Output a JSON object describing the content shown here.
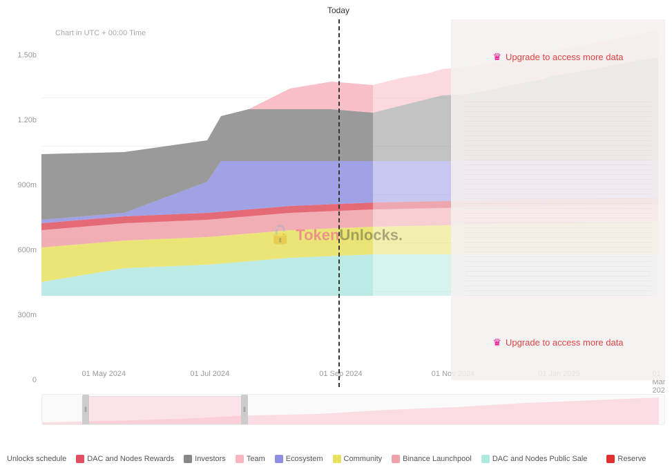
{
  "chart": {
    "title": "Unlocks schedule",
    "subtitle": "Chart in UTC + 00:00 Time",
    "today_label": "Today",
    "watermark": "TokenUnlocks.",
    "y_axis": {
      "labels": [
        "0",
        "300m",
        "600m",
        "900m",
        "1.20b",
        "1.50b"
      ]
    },
    "x_axis": {
      "labels": [
        "01 May 2024",
        "01 Jul 2024",
        "01 Sep 2024",
        "01 Nov 2024",
        "01 Jan 2025",
        "01 Mar 202"
      ]
    },
    "upgrade_messages": [
      "Upgrade to access more data",
      "Upgrade to access more data"
    ]
  },
  "legend": {
    "items": [
      {
        "label": "Unlocks schedule",
        "color": null
      },
      {
        "label": "DAC and Nodes Rewards",
        "color": "#e05060"
      },
      {
        "label": "Investors",
        "color": "#888888"
      },
      {
        "label": "Team",
        "color": "#f8b4c0"
      },
      {
        "label": "Ecosystem",
        "color": "#9090e0"
      },
      {
        "label": "Community",
        "color": "#e8e060"
      },
      {
        "label": "Binance Launchpool",
        "color": "#f0a0a8"
      },
      {
        "label": "DAC and Nodes Public Sale",
        "color": "#b0e8e0"
      },
      {
        "label": "Reserve",
        "color": "#e03030"
      }
    ]
  }
}
